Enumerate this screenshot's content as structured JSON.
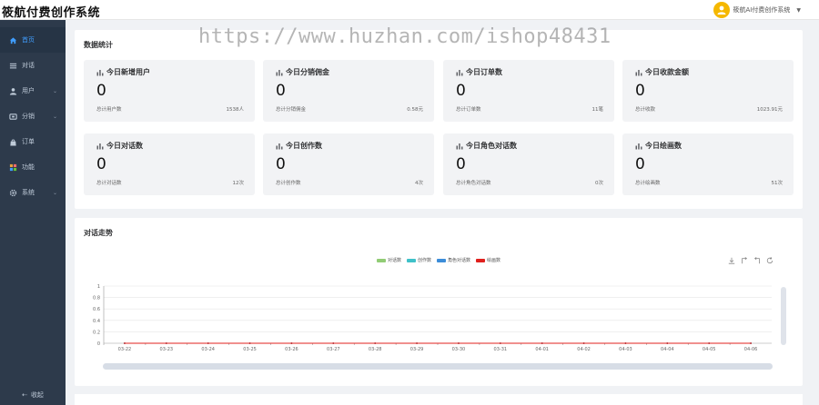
{
  "header": {
    "brand": "筱航付费创作系统",
    "user_name": "筱航AI付费创作系统",
    "caret": "▼"
  },
  "watermark": "https://www.huzhan.com/ishop48431",
  "sidebar": {
    "items": [
      {
        "label": "首页",
        "icon": "home-icon",
        "active": true,
        "has_children": false
      },
      {
        "label": "对话",
        "icon": "menu-icon",
        "active": false,
        "has_children": false
      },
      {
        "label": "用户",
        "icon": "user-icon",
        "active": false,
        "has_children": true
      },
      {
        "label": "分销",
        "icon": "share-icon",
        "active": false,
        "has_children": true
      },
      {
        "label": "订单",
        "icon": "bag-icon",
        "active": false,
        "has_children": false
      },
      {
        "label": "功能",
        "icon": "grid-icon",
        "active": false,
        "has_children": false
      },
      {
        "label": "系统",
        "icon": "gear-icon",
        "active": false,
        "has_children": true
      }
    ],
    "collapse_label": "收起"
  },
  "stats": {
    "title": "数据统计",
    "cards": [
      {
        "title": "今日新增用户",
        "value": "0",
        "sub": "总计用户数",
        "total": "1538人"
      },
      {
        "title": "今日分销佣金",
        "value": "0",
        "sub": "总计分销佣金",
        "total": "0.58元"
      },
      {
        "title": "今日订单数",
        "value": "0",
        "sub": "总计订单数",
        "total": "11笔"
      },
      {
        "title": "今日收款金额",
        "value": "0",
        "sub": "总计收款",
        "total": "1023.91元"
      },
      {
        "title": "今日对话数",
        "value": "0",
        "sub": "总计对话数",
        "total": "12次"
      },
      {
        "title": "今日创作数",
        "value": "0",
        "sub": "总计创作数",
        "total": "4次"
      },
      {
        "title": "今日角色对话数",
        "value": "0",
        "sub": "总计角色对话数",
        "total": "0次"
      },
      {
        "title": "今日绘画数",
        "value": "0",
        "sub": "总计绘画数",
        "total": "51次"
      }
    ]
  },
  "trend": {
    "title": "对话走势",
    "toolbox": [
      "download-icon",
      "restore-icon",
      "zoom-icon",
      "refresh-icon"
    ]
  },
  "chart_data": {
    "type": "line",
    "title": "对话走势",
    "x": [
      "03-22",
      "03-23",
      "03-24",
      "03-25",
      "03-26",
      "03-27",
      "03-28",
      "03-29",
      "03-30",
      "03-31",
      "04-01",
      "04-02",
      "04-03",
      "04-04",
      "04-05",
      "04-06"
    ],
    "y_ticks": [
      "0",
      "0.2",
      "0.4",
      "0.6",
      "0.8",
      "1"
    ],
    "ylim": [
      0,
      1
    ],
    "grid": true,
    "legend_position": "top-center",
    "series": [
      {
        "name": "对话数",
        "color": "#91cc75",
        "values": [
          0,
          0,
          0,
          0,
          0,
          0,
          0,
          0,
          0,
          0,
          0,
          0,
          0,
          0,
          0,
          0
        ]
      },
      {
        "name": "创作数",
        "color": "#3fc1c9",
        "values": [
          0,
          0,
          0,
          0,
          0,
          0,
          0,
          0,
          0,
          0,
          0,
          0,
          0,
          0,
          0,
          0
        ]
      },
      {
        "name": "角色对话数",
        "color": "#3c8dd9",
        "values": [
          0,
          0,
          0,
          0,
          0,
          0,
          0,
          0,
          0,
          0,
          0,
          0,
          0,
          0,
          0,
          0
        ]
      },
      {
        "name": "绘画数",
        "color": "#e0201d",
        "values": [
          0,
          0,
          0,
          0,
          0,
          0,
          0,
          0,
          0,
          0,
          0,
          0,
          0,
          0,
          0,
          0
        ]
      }
    ]
  }
}
